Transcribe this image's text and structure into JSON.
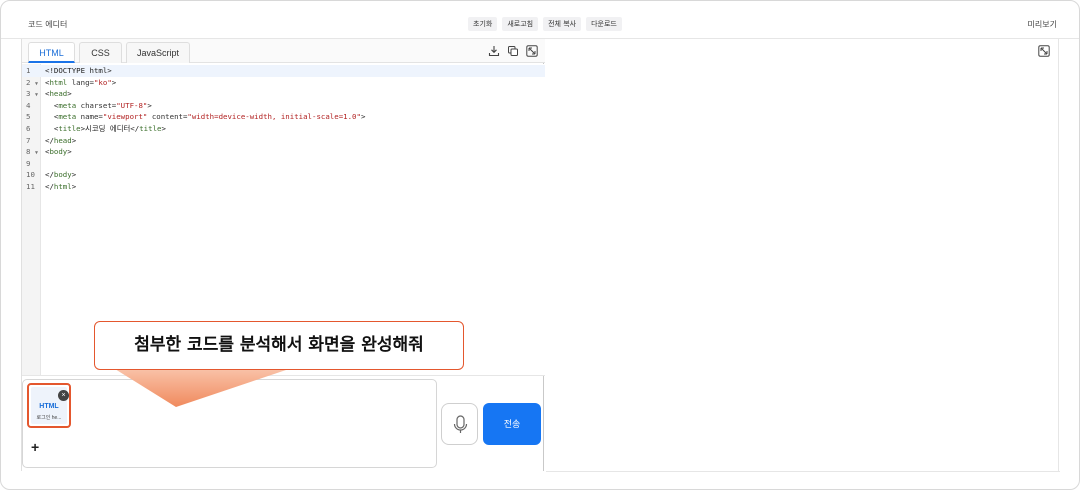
{
  "header": {
    "app_title": "코드 에디터",
    "actions": [
      "초기화",
      "새로고침",
      "전체 복사",
      "다운로드"
    ],
    "preview_label": "미리보기"
  },
  "editor": {
    "tabs": [
      {
        "label": "HTML",
        "active": true
      },
      {
        "label": "CSS",
        "active": false
      },
      {
        "label": "JavaScript",
        "active": false
      }
    ],
    "tab_icons": [
      "download-icon",
      "copy-icon",
      "expand-icon"
    ],
    "active_line": 1,
    "lines": [
      {
        "n": "1",
        "fold": false,
        "segments": [
          [
            "t-plain",
            "<!DOCTYPE html>"
          ]
        ]
      },
      {
        "n": "2",
        "fold": true,
        "segments": [
          [
            "t-plain",
            "<"
          ],
          [
            "t-tag",
            "html"
          ],
          [
            "t-attr",
            " lang="
          ],
          [
            "t-str",
            "\"ko\""
          ],
          [
            "t-plain",
            ">"
          ]
        ]
      },
      {
        "n": "3",
        "fold": true,
        "segments": [
          [
            "t-plain",
            "<"
          ],
          [
            "t-tag",
            "head"
          ],
          [
            "t-plain",
            ">"
          ]
        ]
      },
      {
        "n": "4",
        "fold": false,
        "segments": [
          [
            "t-plain",
            "  <"
          ],
          [
            "t-tag",
            "meta"
          ],
          [
            "t-attr",
            " charset="
          ],
          [
            "t-str",
            "\"UTF-8\""
          ],
          [
            "t-plain",
            ">"
          ]
        ]
      },
      {
        "n": "5",
        "fold": false,
        "segments": [
          [
            "t-plain",
            "  <"
          ],
          [
            "t-tag",
            "meta"
          ],
          [
            "t-attr",
            " name="
          ],
          [
            "t-str",
            "\"viewport\""
          ],
          [
            "t-attr",
            " content="
          ],
          [
            "t-str",
            "\"width=device-width, initial-scale=1.0\""
          ],
          [
            "t-plain",
            ">"
          ]
        ]
      },
      {
        "n": "6",
        "fold": false,
        "segments": [
          [
            "t-plain",
            "  <"
          ],
          [
            "t-tag",
            "title"
          ],
          [
            "t-plain",
            ">시코딩 에디터</"
          ],
          [
            "t-tag",
            "title"
          ],
          [
            "t-plain",
            ">"
          ]
        ]
      },
      {
        "n": "7",
        "fold": false,
        "segments": [
          [
            "t-plain",
            "</"
          ],
          [
            "t-tag",
            "head"
          ],
          [
            "t-plain",
            ">"
          ]
        ]
      },
      {
        "n": "8",
        "fold": true,
        "segments": [
          [
            "t-plain",
            "<"
          ],
          [
            "t-tag",
            "body"
          ],
          [
            "t-plain",
            ">"
          ]
        ]
      },
      {
        "n": "9",
        "fold": false,
        "segments": []
      },
      {
        "n": "10",
        "fold": false,
        "segments": [
          [
            "t-plain",
            "</"
          ],
          [
            "t-tag",
            "body"
          ],
          [
            "t-plain",
            ">"
          ]
        ]
      },
      {
        "n": "11",
        "fold": false,
        "segments": [
          [
            "t-plain",
            "</"
          ],
          [
            "t-tag",
            "html"
          ],
          [
            "t-plain",
            ">"
          ]
        ]
      }
    ]
  },
  "chat": {
    "attachment": {
      "type": "HTML",
      "name": "로그인 he..."
    },
    "attachment_close": "×",
    "plus": "+",
    "send_label": "전송"
  },
  "callout": {
    "text": "첨부한 코드를 분석해서 화면을 완성해줘"
  },
  "colors": {
    "accent": "#1676f3",
    "highlight": "#e4572e"
  }
}
